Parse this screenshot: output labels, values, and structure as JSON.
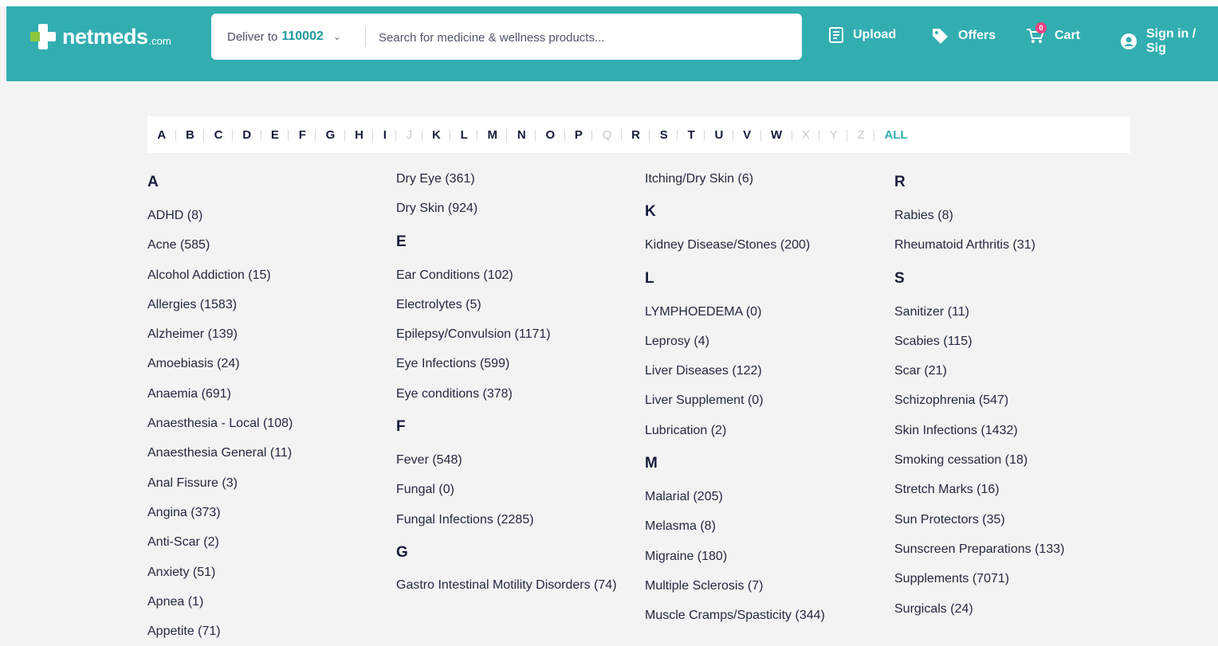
{
  "header": {
    "logo_text": "netmeds",
    "logo_suffix": ".com",
    "deliver_label": "Deliver to",
    "pincode": "110002",
    "search_placeholder": "Search for medicine & wellness products...",
    "upload": "Upload",
    "offers": "Offers",
    "cart": "Cart",
    "cart_count": "0",
    "signin": "Sign in / Sig"
  },
  "alphabet": [
    {
      "l": "A",
      "enabled": true
    },
    {
      "l": "B",
      "enabled": true
    },
    {
      "l": "C",
      "enabled": true
    },
    {
      "l": "D",
      "enabled": true
    },
    {
      "l": "E",
      "enabled": true
    },
    {
      "l": "F",
      "enabled": true
    },
    {
      "l": "G",
      "enabled": true
    },
    {
      "l": "H",
      "enabled": true
    },
    {
      "l": "I",
      "enabled": true
    },
    {
      "l": "J",
      "enabled": false
    },
    {
      "l": "K",
      "enabled": true
    },
    {
      "l": "L",
      "enabled": true
    },
    {
      "l": "M",
      "enabled": true
    },
    {
      "l": "N",
      "enabled": true
    },
    {
      "l": "O",
      "enabled": true
    },
    {
      "l": "P",
      "enabled": true
    },
    {
      "l": "Q",
      "enabled": false
    },
    {
      "l": "R",
      "enabled": true
    },
    {
      "l": "S",
      "enabled": true
    },
    {
      "l": "T",
      "enabled": true
    },
    {
      "l": "U",
      "enabled": true
    },
    {
      "l": "V",
      "enabled": true
    },
    {
      "l": "W",
      "enabled": true
    },
    {
      "l": "X",
      "enabled": false
    },
    {
      "l": "Y",
      "enabled": false
    },
    {
      "l": "Z",
      "enabled": false
    },
    {
      "l": "ALL",
      "enabled": true,
      "all": true
    }
  ],
  "columns": [
    [
      {
        "h": "A"
      },
      {
        "i": "ADHD (8)"
      },
      {
        "i": "Acne (585)"
      },
      {
        "i": "Alcohol Addiction (15)"
      },
      {
        "i": "Allergies (1583)"
      },
      {
        "i": "Alzheimer (139)"
      },
      {
        "i": "Amoebiasis (24)"
      },
      {
        "i": "Anaemia (691)"
      },
      {
        "i": "Anaesthesia - Local (108)"
      },
      {
        "i": "Anaesthesia General (11)"
      },
      {
        "i": "Anal Fissure (3)"
      },
      {
        "i": "Angina (373)"
      },
      {
        "i": "Anti-Scar (2)"
      },
      {
        "i": "Anxiety (51)"
      },
      {
        "i": "Apnea (1)"
      },
      {
        "i": "Appetite (71)"
      }
    ],
    [
      {
        "i": "Dry Eye (361)"
      },
      {
        "i": "Dry Skin (924)"
      },
      {
        "h": "E"
      },
      {
        "i": "Ear Conditions (102)"
      },
      {
        "i": "Electrolytes (5)"
      },
      {
        "i": "Epilepsy/Convulsion (1171)"
      },
      {
        "i": "Eye Infections (599)"
      },
      {
        "i": "Eye conditions (378)"
      },
      {
        "h": "F"
      },
      {
        "i": "Fever (548)"
      },
      {
        "i": "Fungal (0)"
      },
      {
        "i": "Fungal Infections (2285)"
      },
      {
        "h": "G"
      },
      {
        "i": "Gastro Intestinal Motility Disorders (74)",
        "wrap": true
      }
    ],
    [
      {
        "i": "Itching/Dry Skin (6)"
      },
      {
        "h": "K"
      },
      {
        "i": "Kidney Disease/Stones (200)"
      },
      {
        "h": "L"
      },
      {
        "i": "LYMPHOEDEMA (0)"
      },
      {
        "i": "Leprosy (4)"
      },
      {
        "i": "Liver Diseases (122)"
      },
      {
        "i": "Liver Supplement (0)"
      },
      {
        "i": "Lubrication (2)"
      },
      {
        "h": "M"
      },
      {
        "i": "Malarial (205)"
      },
      {
        "i": "Melasma (8)"
      },
      {
        "i": "Migraine (180)"
      },
      {
        "i": "Multiple Sclerosis (7)"
      },
      {
        "i": "Muscle Cramps/Spasticity (344)"
      }
    ],
    [
      {
        "h": "R"
      },
      {
        "i": "Rabies (8)"
      },
      {
        "i": "Rheumatoid Arthritis (31)"
      },
      {
        "h": "S"
      },
      {
        "i": "Sanitizer (11)"
      },
      {
        "i": "Scabies (115)"
      },
      {
        "i": "Scar (21)"
      },
      {
        "i": "Schizophrenia (547)"
      },
      {
        "i": "Skin Infections (1432)"
      },
      {
        "i": "Smoking cessation (18)"
      },
      {
        "i": "Stretch Marks (16)"
      },
      {
        "i": "Sun Protectors (35)"
      },
      {
        "i": "Sunscreen Preparations (133)"
      },
      {
        "i": "Supplements (7071)"
      },
      {
        "i": "Surgicals (24)"
      }
    ]
  ]
}
